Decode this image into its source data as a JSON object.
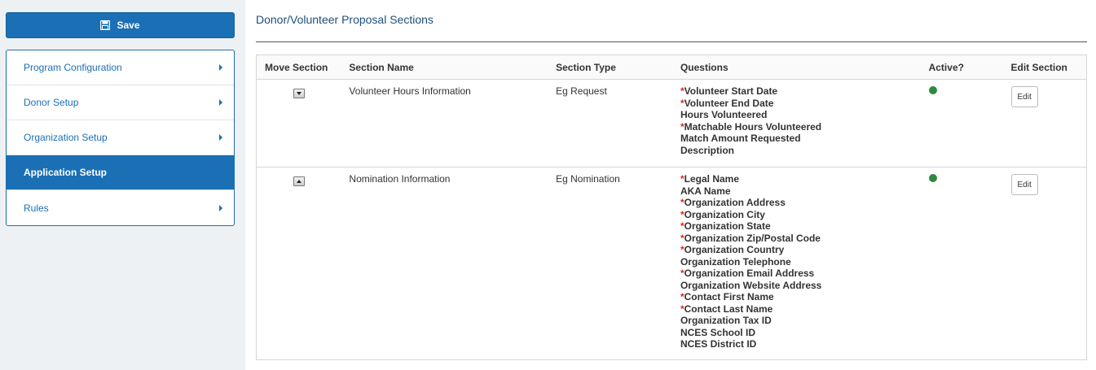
{
  "sidebar": {
    "save_label": "Save",
    "items": [
      {
        "label": "Program Configuration",
        "active": false
      },
      {
        "label": "Donor Setup",
        "active": false
      },
      {
        "label": "Organization Setup",
        "active": false
      },
      {
        "label": "Application Setup",
        "active": true
      },
      {
        "label": "Rules",
        "active": false
      }
    ]
  },
  "main": {
    "title": "Donor/Volunteer Proposal Sections",
    "table": {
      "headers": [
        "Move Section",
        "Section Name",
        "Section Type",
        "Questions",
        "Active?",
        "Edit Section"
      ],
      "rows": [
        {
          "move": "down",
          "name": "Volunteer Hours Information",
          "type": "Eg Request",
          "active": true,
          "active_color": "#2e8b3e",
          "edit_label": "Edit",
          "questions": [
            {
              "text": "Volunteer Start Date",
              "required": true
            },
            {
              "text": "Volunteer End Date",
              "required": true
            },
            {
              "text": "Hours Volunteered",
              "required": false
            },
            {
              "text": "Matchable Hours Volunteered",
              "required": true
            },
            {
              "text": "Match Amount Requested",
              "required": false
            },
            {
              "text": "Description",
              "required": false
            }
          ]
        },
        {
          "move": "up",
          "name": "Nomination Information",
          "type": "Eg Nomination",
          "active": true,
          "active_color": "#2e8b3e",
          "edit_label": "Edit",
          "questions": [
            {
              "text": "Legal Name",
              "required": true
            },
            {
              "text": "AKA Name",
              "required": false
            },
            {
              "text": "Organization Address",
              "required": true
            },
            {
              "text": "Organization City",
              "required": true
            },
            {
              "text": "Organization State",
              "required": true
            },
            {
              "text": "Organization Zip/Postal Code",
              "required": true
            },
            {
              "text": "Organization Country",
              "required": true
            },
            {
              "text": "Organization Telephone",
              "required": false
            },
            {
              "text": "Organization Email Address",
              "required": true
            },
            {
              "text": "Organization Website Address",
              "required": false
            },
            {
              "text": "Contact First Name",
              "required": true
            },
            {
              "text": "Contact Last Name",
              "required": true
            },
            {
              "text": "Organization Tax ID",
              "required": false
            },
            {
              "text": "NCES School ID",
              "required": false
            },
            {
              "text": "NCES District ID",
              "required": false
            }
          ]
        }
      ]
    }
  },
  "colors": {
    "brand": "#1b6fb5",
    "required": "#d9261c",
    "active": "#2e8b3e"
  },
  "icons": {
    "save": "floppy-disk-icon",
    "menu_caret": "caret-right-icon",
    "move_down": "arrow-down-icon",
    "move_up": "arrow-up-icon"
  }
}
